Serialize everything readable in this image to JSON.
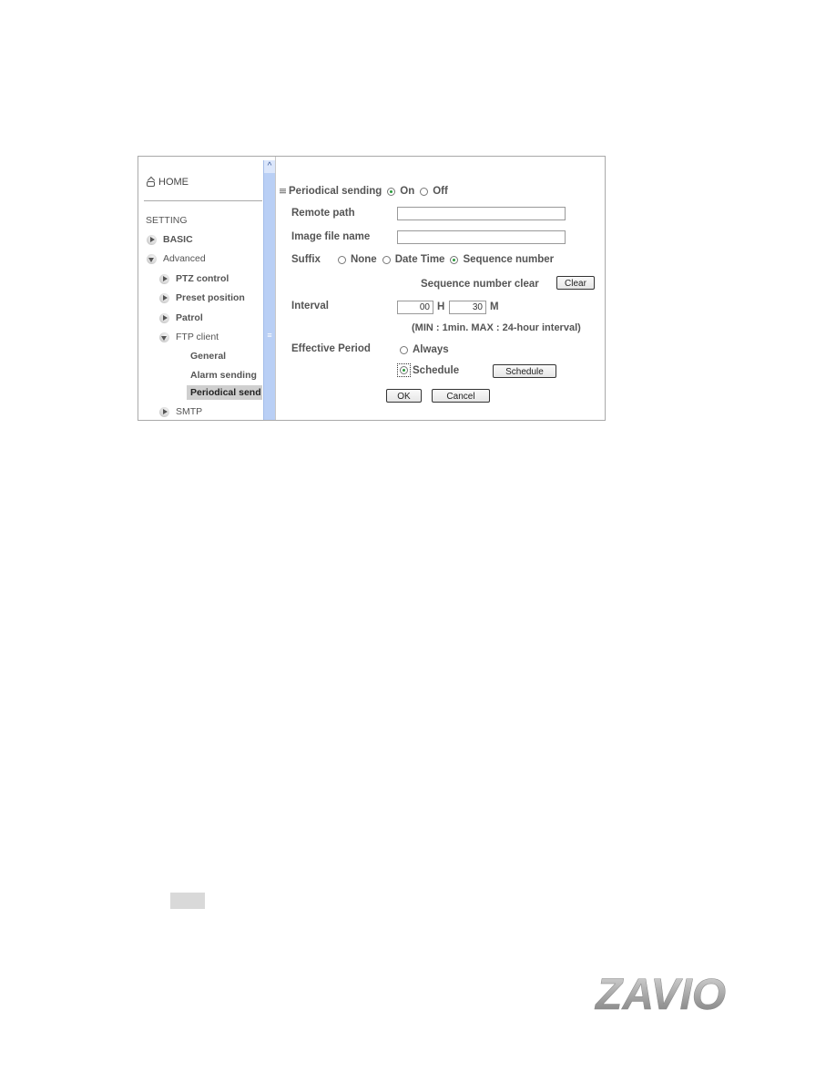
{
  "sidebar": {
    "home_label": "HOME",
    "setting_label": "SETTING",
    "items": [
      {
        "label": "BASIC",
        "state": "collapsed"
      },
      {
        "label": "Advanced",
        "state": "expanded"
      }
    ],
    "advanced_items": [
      {
        "label": "PTZ control",
        "state": "collapsed"
      },
      {
        "label": "Preset position",
        "state": "collapsed"
      },
      {
        "label": "Patrol",
        "state": "collapsed"
      },
      {
        "label": "FTP client",
        "state": "expanded"
      }
    ],
    "ftp_items": [
      {
        "label": "General"
      },
      {
        "label": "Alarm sending"
      },
      {
        "label": "Periodical send",
        "active": true
      }
    ],
    "trailing_item": {
      "label": "SMTP",
      "state": "collapsed"
    }
  },
  "form": {
    "section_title": "Periodical sending",
    "on_label": "On",
    "off_label": "Off",
    "periodical_sending_value": "On",
    "remote_path_label": "Remote path",
    "remote_path_value": "",
    "image_file_name_label": "Image file name",
    "image_file_name_value": "",
    "suffix_label": "Suffix",
    "suffix_options": [
      "None",
      "Date Time",
      "Sequence number"
    ],
    "suffix_value": "Sequence number",
    "sequence_clear_label": "Sequence number clear",
    "clear_button": "Clear",
    "interval_label": "Interval",
    "interval_hours": "00",
    "interval_hours_unit": "H",
    "interval_minutes": "30",
    "interval_minutes_unit": "M",
    "interval_note": "(MIN : 1min. MAX : 24-hour interval)",
    "effective_period_label": "Effective Period",
    "always_label": "Always",
    "schedule_label": "Schedule",
    "effective_period_value": "Schedule",
    "schedule_button": "Schedule",
    "ok_button": "OK",
    "cancel_button": "Cancel"
  },
  "logo": {
    "text": "ZAVIO"
  }
}
